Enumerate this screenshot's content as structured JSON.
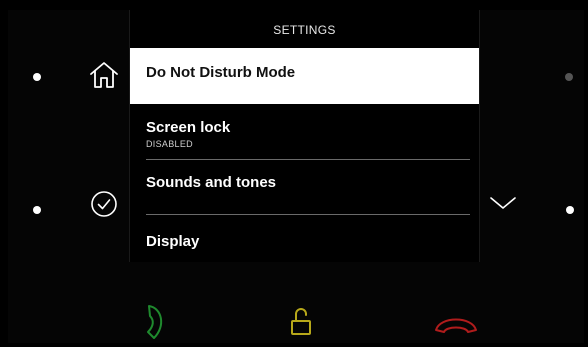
{
  "screen": {
    "title": "SETTINGS",
    "menu": [
      {
        "label": "Do Not Disturb Mode",
        "sub": "",
        "selected": true
      },
      {
        "label": "Screen lock",
        "sub": "DISABLED",
        "selected": false
      },
      {
        "label": "Sounds and tones",
        "sub": "",
        "selected": false
      },
      {
        "label": "Display",
        "sub": "",
        "selected": false
      }
    ]
  },
  "icons": {
    "home": "home-icon",
    "confirm": "check-circle-icon",
    "scroll_down": "chevron-down-icon",
    "call_answer": "phone-answer-icon",
    "unlock": "unlock-icon",
    "call_hangup": "phone-hangup-icon"
  },
  "colors": {
    "answer": "#1f8a2e",
    "unlock": "#b7a81a",
    "hangup": "#b01c1c",
    "selected_bg": "#ffffff"
  }
}
